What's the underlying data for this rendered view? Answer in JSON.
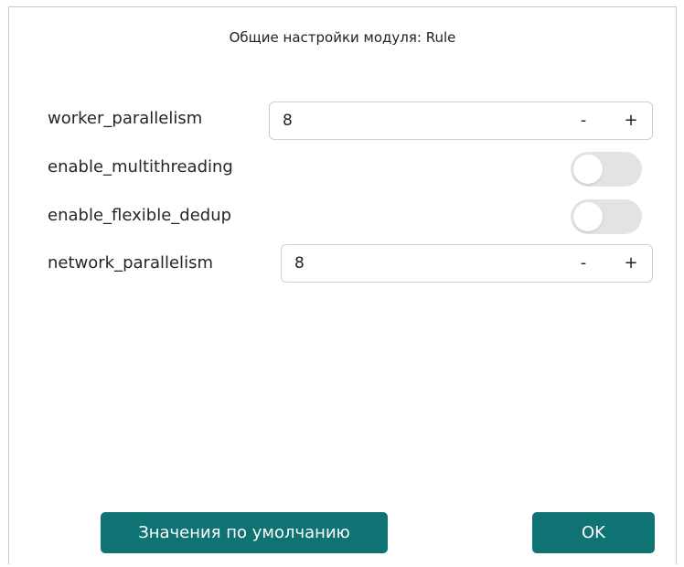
{
  "dialog": {
    "title": "Общие настройки модуля: Rule"
  },
  "settings": [
    {
      "label": "worker_parallelism",
      "type": "spinbox",
      "value": "8",
      "minus": "-",
      "plus": "+"
    },
    {
      "label": "enable_multithreading",
      "type": "toggle",
      "checked": false
    },
    {
      "label": "enable_flexible_dedup",
      "type": "toggle",
      "checked": false
    },
    {
      "label": "network_parallelism",
      "type": "spinbox",
      "value": "8",
      "minus": "-",
      "plus": "+"
    }
  ],
  "footer": {
    "defaults_label": "Значения по умолчанию",
    "ok_label": "OK"
  },
  "colors": {
    "accent": "#0f7273",
    "toggle_off": "#e3e3e3",
    "border": "#cfcfcf"
  }
}
